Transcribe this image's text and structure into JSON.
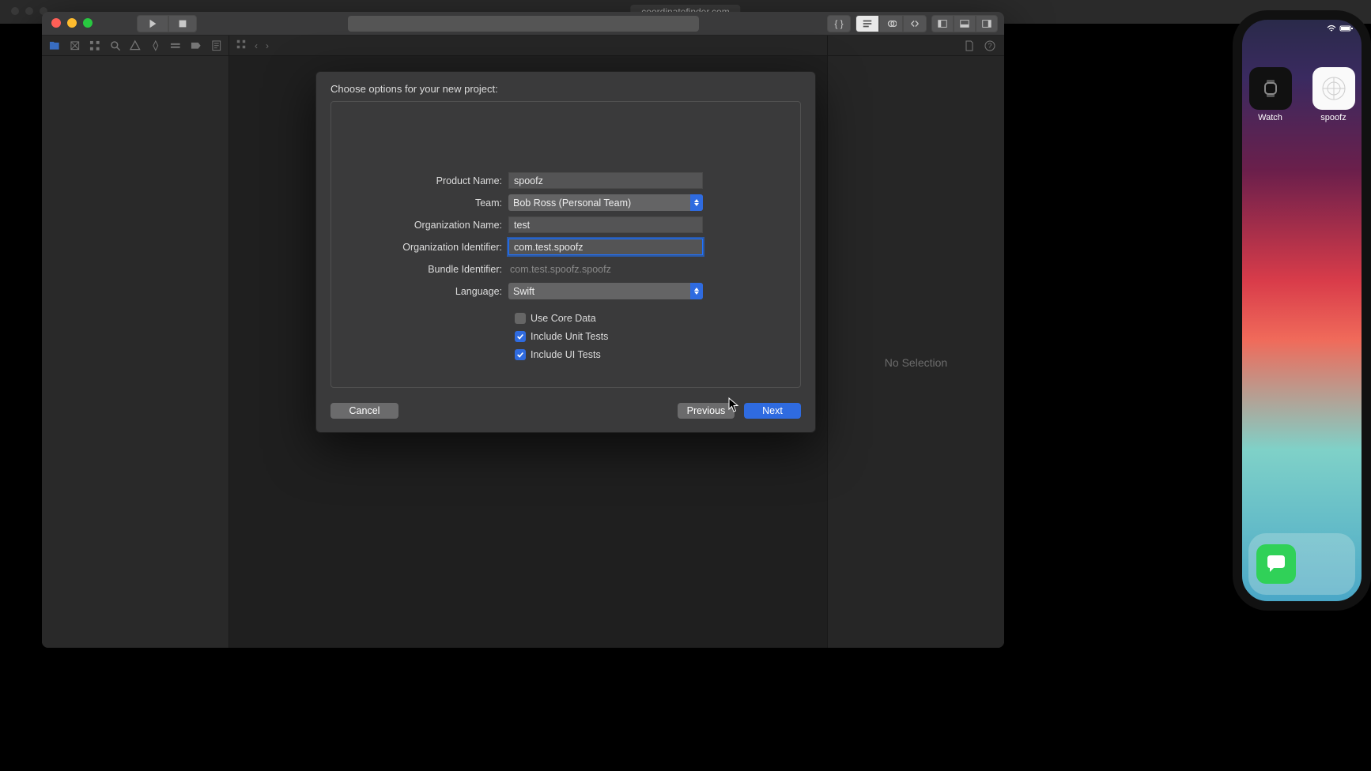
{
  "browser": {
    "address": "coordinatefinder.com"
  },
  "sheet": {
    "title": "Choose options for your new project:",
    "labels": {
      "product_name": "Product Name:",
      "team": "Team:",
      "org_name": "Organization Name:",
      "org_id": "Organization Identifier:",
      "bundle_id": "Bundle Identifier:",
      "language": "Language:"
    },
    "values": {
      "product_name": "spoofz",
      "team": "Bob Ross (Personal Team)",
      "org_name": "test",
      "org_id": "com.test.spoofz",
      "bundle_id": "com.test.spoofz.spoofz",
      "language": "Swift"
    },
    "checks": {
      "core_data": {
        "label": "Use Core Data",
        "checked": false
      },
      "unit_tests": {
        "label": "Include Unit Tests",
        "checked": true
      },
      "ui_tests": {
        "label": "Include UI Tests",
        "checked": true
      }
    },
    "buttons": {
      "cancel": "Cancel",
      "previous": "Previous",
      "next": "Next"
    }
  },
  "util_pane": {
    "empty_text": "No Selection"
  },
  "simulator": {
    "apps": {
      "watch": "Watch",
      "spoofz": "spoofz"
    }
  }
}
